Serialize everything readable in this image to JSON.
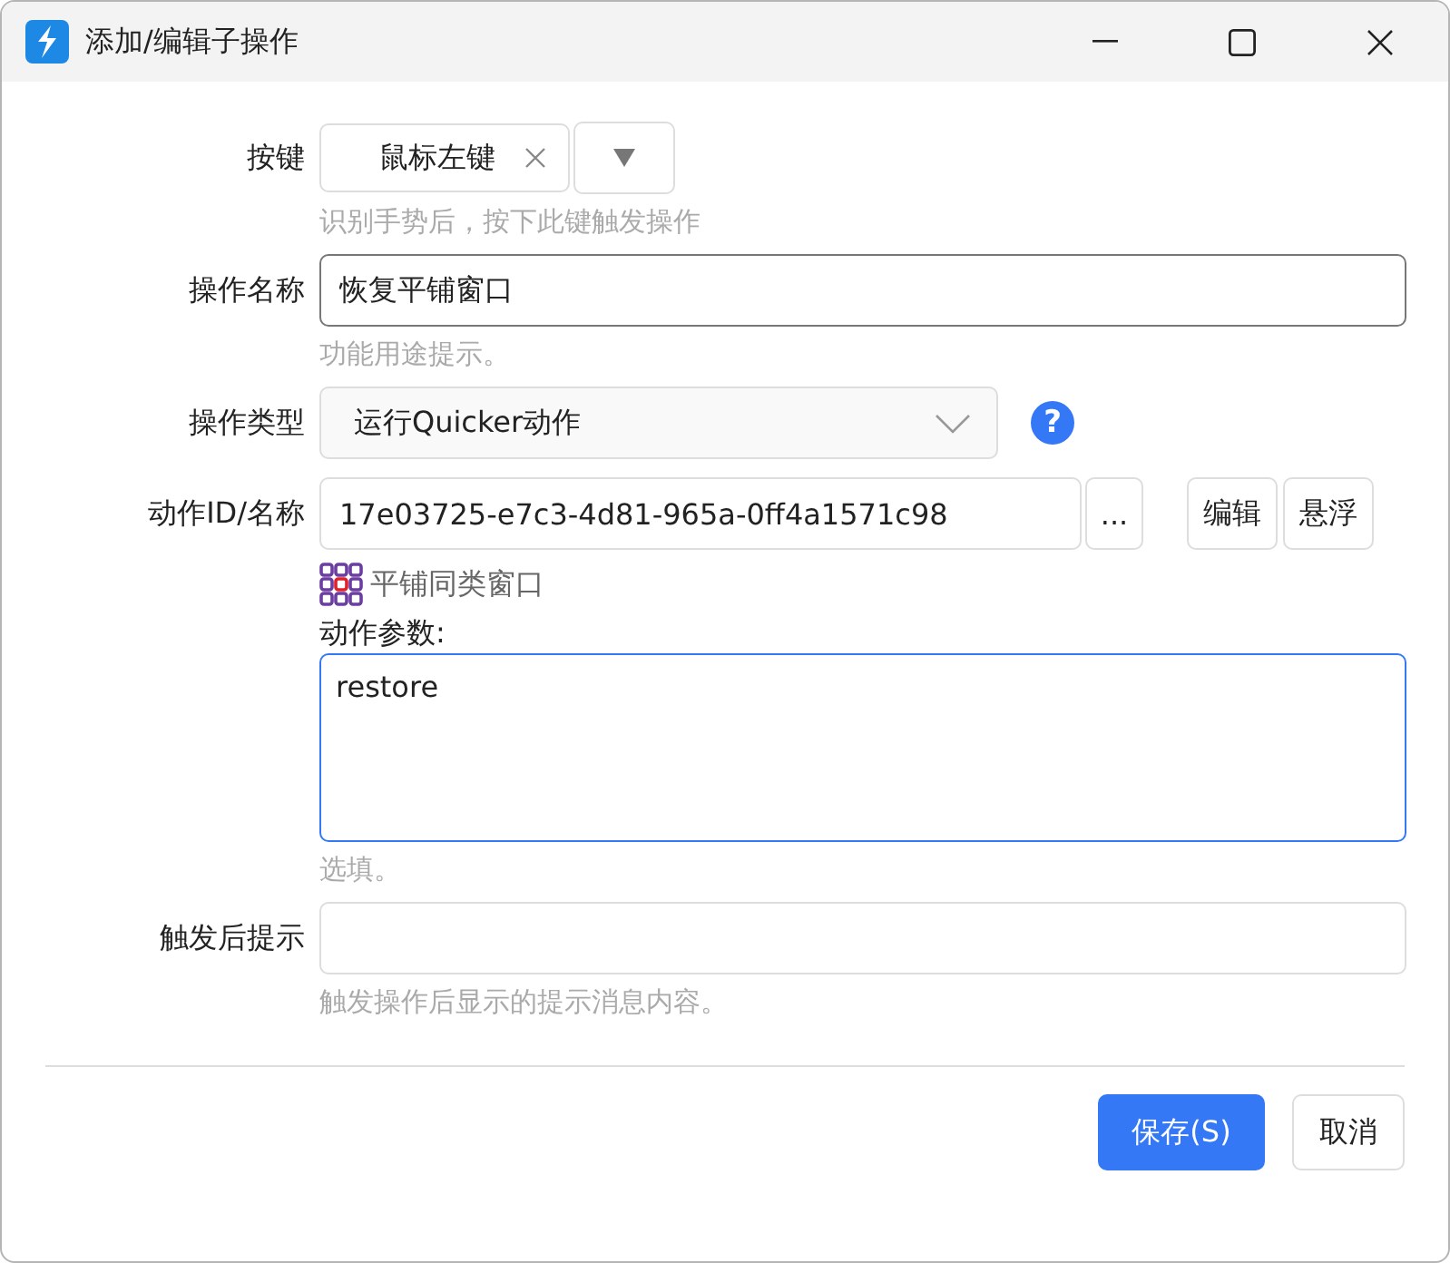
{
  "window": {
    "title": "添加/编辑子操作"
  },
  "key": {
    "label": "按键",
    "value": "鼠标左键",
    "hint": "识别手势后，按下此键触发操作"
  },
  "name": {
    "label": "操作名称",
    "value": "恢复平铺窗口",
    "hint": "功能用途提示。"
  },
  "type": {
    "label": "操作类型",
    "value": "运行Quicker动作",
    "help": "?"
  },
  "action": {
    "label": "动作ID/名称",
    "value": "17e03725-e7c3-4d81-965a-0ff4a1571c98",
    "browse": "...",
    "buttons": [
      "编辑",
      "悬浮"
    ],
    "action_name": "平铺同类窗口",
    "params_label": "动作参数:",
    "params_value": "restore",
    "params_hint": "选填。"
  },
  "notify": {
    "label": "触发后提示",
    "hint": "触发操作后显示的提示消息内容。"
  },
  "footer": [
    {
      "label": "保存(S)",
      "kind": "primary"
    },
    {
      "label": "取消",
      "kind": "secondary"
    }
  ]
}
